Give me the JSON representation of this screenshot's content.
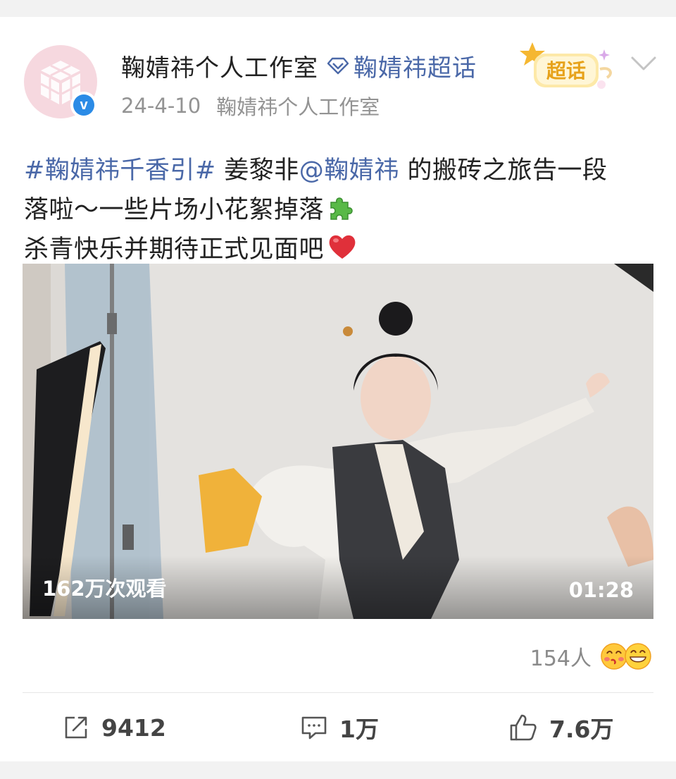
{
  "post": {
    "author": "鞠婧祎个人工作室",
    "supertopic_link": "鞠婧祎超话",
    "supertopic_badge": "超话",
    "date": "24-4-10",
    "source": "鞠婧祎个人工作室",
    "text": {
      "hashtag": "#鞠婧祎千香引#",
      "line1_a": " 姜黎非",
      "mention": "@鞠婧祎",
      "line1_b": " 的搬砖之旅告一段",
      "line2": "落啦～一些片场小花絮掉落",
      "line2_emoji": "puzzle-piece-emoji",
      "line3": "杀青快乐并期待正式见面吧",
      "line3_emoji": "red-heart-emoji"
    }
  },
  "video": {
    "views": "162万次观看",
    "duration": "01:28"
  },
  "reactions": {
    "count": "154人",
    "icons": [
      "kiss-face-emoji",
      "grin-face-emoji"
    ]
  },
  "actions": {
    "share": {
      "icon": "share-icon",
      "count": "9412"
    },
    "comment": {
      "icon": "comment-icon",
      "count": "1万"
    },
    "like": {
      "icon": "thumbs-up-icon",
      "count": "7.6万"
    }
  },
  "colors": {
    "link": "#4a68a8",
    "verified": "#2b8be6",
    "meta": "#939393",
    "heart": "#e0303a"
  }
}
